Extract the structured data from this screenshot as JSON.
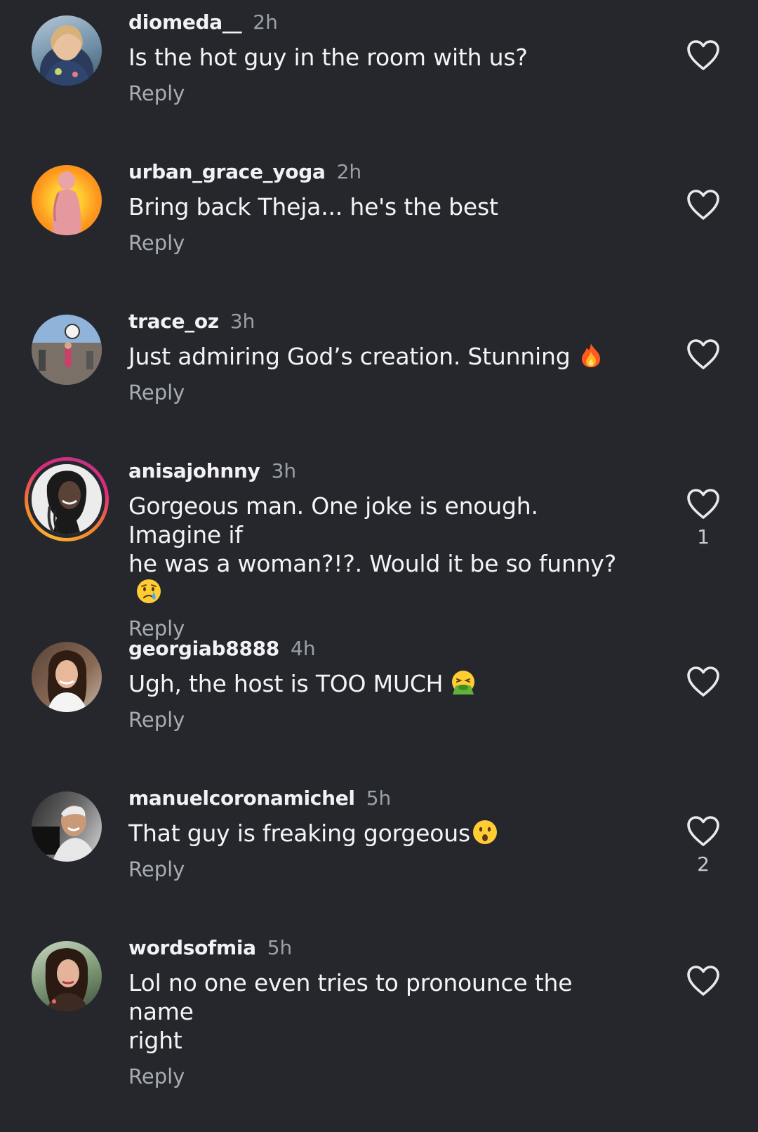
{
  "comments": [
    {
      "username": "diomeda__",
      "time": "2h",
      "text": "Is the hot guy in the room with us?",
      "reply_label": "Reply",
      "like_count": ""
    },
    {
      "username": "urban_grace_yoga",
      "time": "2h",
      "text": "Bring back Theja... he's the best",
      "reply_label": "Reply",
      "like_count": ""
    },
    {
      "username": "trace_oz",
      "time": "3h",
      "text": "Just admiring God’s creation. Stunning",
      "emoji": "fire-emoji",
      "reply_label": "Reply",
      "like_count": ""
    },
    {
      "username": "anisajohnny",
      "time": "3h",
      "text_line1": "Gorgeous man. One joke is enough. Imagine if",
      "text_line2": "he was a woman?!?. Would it be so funny?",
      "emoji": "crying-face-emoji",
      "reply_label": "Reply",
      "like_count": "1",
      "has_story_ring": true
    },
    {
      "username": "georgiab8888",
      "time": "4h",
      "text": "Ugh, the host is TOO MUCH",
      "emoji": "vomiting-face-emoji",
      "reply_label": "Reply",
      "like_count": ""
    },
    {
      "username": "manuelcoronamichel",
      "time": "5h",
      "text": "That guy is freaking gorgeous",
      "emoji": "astonished-face-emoji",
      "reply_label": "Reply",
      "like_count": "2"
    },
    {
      "username": "wordsofmia",
      "time": "5h",
      "text_line1": "Lol no one even tries to pronounce the name",
      "text_line2": "right",
      "reply_label": "Reply",
      "like_count": ""
    }
  ],
  "colors": {
    "background": "#25272d",
    "username": "#f2f2f4",
    "timestamp": "#9aa0aa",
    "reply": "#a7acb5",
    "heart_outline": "#e9e9ec"
  }
}
